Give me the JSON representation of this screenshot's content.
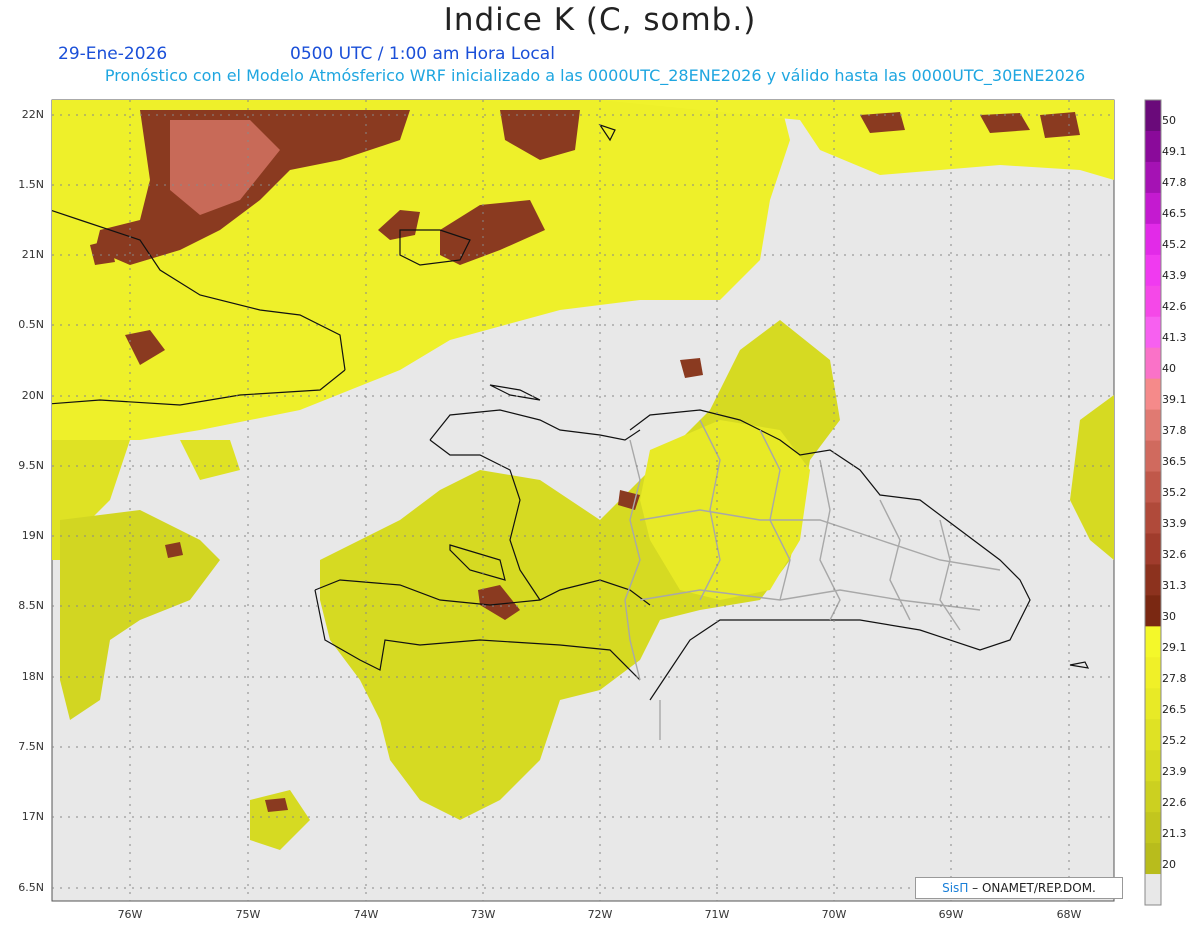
{
  "header": {
    "title": "Indice K (C, somb.)",
    "date": "29-Ene-2026",
    "time": "0500 UTC / 1:00 am Hora Local",
    "subtitle": "Pronóstico con el Modelo Atmósferico WRF inicializado a las 0000UTC_28ENE2026 y válido hasta las  0000UTC_30ENE2026"
  },
  "map": {
    "lat_labels": [
      "22N",
      "1.5N",
      "21N",
      "0.5N",
      "20N",
      "9.5N",
      "19N",
      "8.5N",
      "18N",
      "7.5N",
      "17N",
      "6.5N"
    ],
    "lon_labels": [
      "76W",
      "75W",
      "74W",
      "73W",
      "72W",
      "71W",
      "70W",
      "69W",
      "68W"
    ],
    "background_color": "#e8e8e8",
    "border_color": "#111111",
    "province_color": "#a8a8a8"
  },
  "colorbar": {
    "levels": [
      "50",
      "49.1",
      "47.8",
      "46.5",
      "45.2",
      "43.9",
      "42.6",
      "41.3",
      "40",
      "39.1",
      "37.8",
      "36.5",
      "35.2",
      "33.9",
      "32.6",
      "31.3",
      "30",
      "29.1",
      "27.8",
      "26.5",
      "25.2",
      "23.9",
      "22.6",
      "21.3",
      "20"
    ],
    "colors": [
      "#6a0a7a",
      "#8a0a9a",
      "#a512b4",
      "#c41ad0",
      "#e22ae8",
      "#f03af0",
      "#f548e8",
      "#f760f0",
      "#fa72c8",
      "#f58a8a",
      "#e07a72",
      "#d06a5e",
      "#c0584a",
      "#b04a3a",
      "#a03c2c",
      "#8c321e",
      "#7a2812",
      "#f4f82a",
      "#f0f028",
      "#e8ea26",
      "#dfe224",
      "#d6da22",
      "#ccd020",
      "#c2c61e",
      "#b8bc1c",
      "#e8e8e8"
    ]
  },
  "credit": {
    "brand": "SisΠ",
    "text": " – ONAMET/REP.DOM."
  }
}
